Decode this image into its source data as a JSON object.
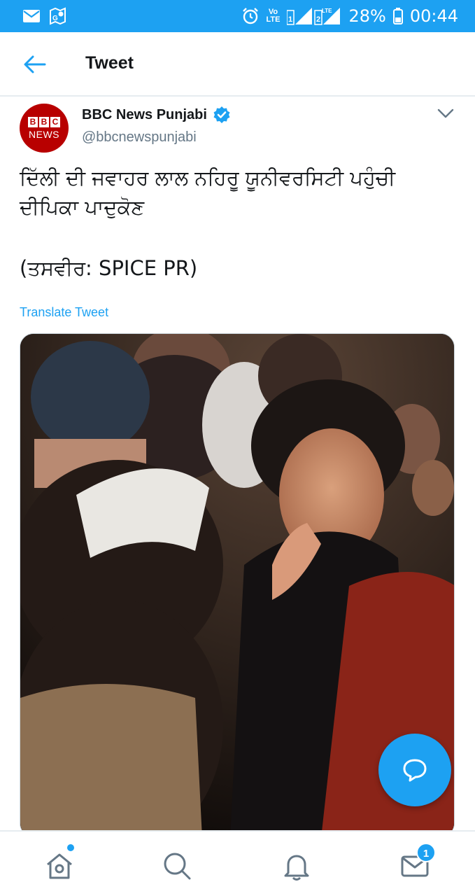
{
  "status_bar": {
    "battery": "28%",
    "time": "00:44",
    "volte_top": "Vo",
    "volte_bottom": "LTE",
    "sim1": "1",
    "sim2": "2",
    "lte": "LTE"
  },
  "app_bar": {
    "title": "Tweet"
  },
  "tweet": {
    "avatar_letters": [
      "B",
      "B",
      "C"
    ],
    "avatar_news": "NEWS",
    "author_name": "BBC News Punjabi",
    "handle": "@bbcnewspunjabi",
    "text": "ਦਿੱਲੀ ਦੀ ਜਵਾਹਰ ਲਾਲ ਨਹਿਰੂ ਯੂਨੀਵਰਸਿਟੀ ਪਹੁੰਚੀ ਦੀਪਿਕਾ ਪਾਦੁਕੋਣ",
    "credit": "(ਤਸਵੀਰ: SPICE PR)",
    "translate_label": "Translate Tweet"
  },
  "bottom_nav": {
    "messages_badge": "1"
  },
  "colors": {
    "accent": "#1da1f2",
    "bbc_red": "#b80000",
    "text": "#14171a",
    "secondary_text": "#657786",
    "divider": "#e6ecf0"
  },
  "icons": [
    "mail-icon",
    "map-icon",
    "alarm-icon",
    "signal-icon",
    "battery-icon",
    "back-arrow-icon",
    "verified-badge-icon",
    "chevron-down-icon",
    "compose-message-icon",
    "home-icon",
    "search-icon",
    "notifications-bell-icon",
    "messages-envelope-icon"
  ]
}
